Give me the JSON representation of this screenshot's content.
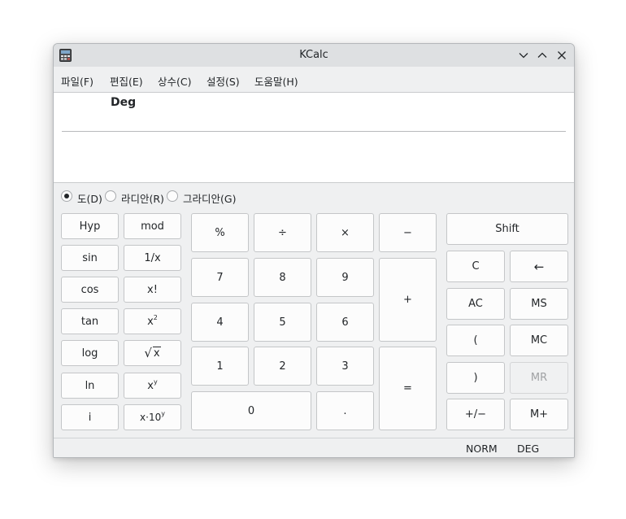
{
  "window": {
    "title": "KCalc"
  },
  "menu": [
    "파일(F)",
    "편집(E)",
    "상수(C)",
    "설정(S)",
    "도움말(H)"
  ],
  "display": {
    "mode_label": "Deg",
    "value": ""
  },
  "angle_modes": [
    {
      "label": "도(D)",
      "checked": true
    },
    {
      "label": "라디안(R)",
      "checked": false
    },
    {
      "label": "그라디안(G)",
      "checked": false
    }
  ],
  "scientific": {
    "hyp": "Hyp",
    "mod": "mod",
    "sin": "sin",
    "reciprocal": "1/x",
    "cos": "cos",
    "factorial": "x!",
    "tan": "tan",
    "square_base": "x",
    "square_exp": "2",
    "log": "log",
    "sqrt_sym": "√",
    "sqrt_x": "x",
    "ln": "ln",
    "power_base": "x",
    "power_exp": "y",
    "i": "i",
    "sci_base": "x·10",
    "sci_exp": "y"
  },
  "keypad": {
    "percent": "%",
    "divide": "÷",
    "multiply": "×",
    "minus": "−",
    "seven": "7",
    "eight": "8",
    "nine": "9",
    "plus": "+",
    "four": "4",
    "five": "5",
    "six": "6",
    "one": "1",
    "two": "2",
    "three": "3",
    "equals": "=",
    "zero": "0",
    "dot": "."
  },
  "memory": {
    "shift": "Shift",
    "clear": "C",
    "backspace": "←",
    "all_clear": "AC",
    "ms": "MS",
    "open_paren": "(",
    "mc": "MC",
    "close_paren": ")",
    "mr": "MR",
    "sign": "+/−",
    "mplus": "M+"
  },
  "status": {
    "base": "NORM",
    "angle": "DEG"
  }
}
